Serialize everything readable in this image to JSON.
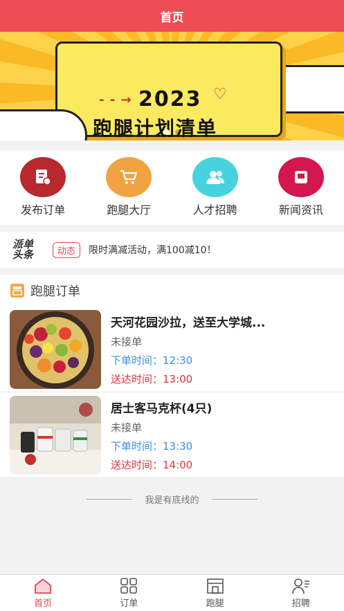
{
  "header": {
    "title": "首页"
  },
  "banner": {
    "year": "2023",
    "title": "跑腿计划清单"
  },
  "quick_actions": [
    {
      "label": "发布订单",
      "color": "#b8282e",
      "icon": "document-icon"
    },
    {
      "label": "跑腿大厅",
      "color": "#f1a341",
      "icon": "cart-icon"
    },
    {
      "label": "人才招聘",
      "color": "#46d3df",
      "icon": "users-icon"
    },
    {
      "label": "新闻资讯",
      "color": "#d4174e",
      "icon": "news-icon"
    }
  ],
  "ticker": {
    "logo_line1": "派单",
    "logo_line2": "头条",
    "badge": "动态",
    "text": "限时满减活动，满100减10！"
  },
  "orders": {
    "title": "跑腿订单",
    "items": [
      {
        "title": "天河花园沙拉，送至大学城...",
        "status": "未接单",
        "order_time": "下单时间：12:30",
        "deliver_time": "送达时间：13:00"
      },
      {
        "title": "居士客马克杯(4只)",
        "status": "未接单",
        "order_time": "下单时间：13:30",
        "deliver_time": "送达时间：14:00"
      }
    ]
  },
  "footer": {
    "text": "我是有底线的"
  },
  "tabbar": [
    {
      "label": "首页",
      "icon": "home-icon",
      "active": true
    },
    {
      "label": "订单",
      "icon": "grid-icon",
      "active": false
    },
    {
      "label": "跑腿",
      "icon": "store-icon",
      "active": false
    },
    {
      "label": "招聘",
      "icon": "person-icon",
      "active": false
    }
  ]
}
